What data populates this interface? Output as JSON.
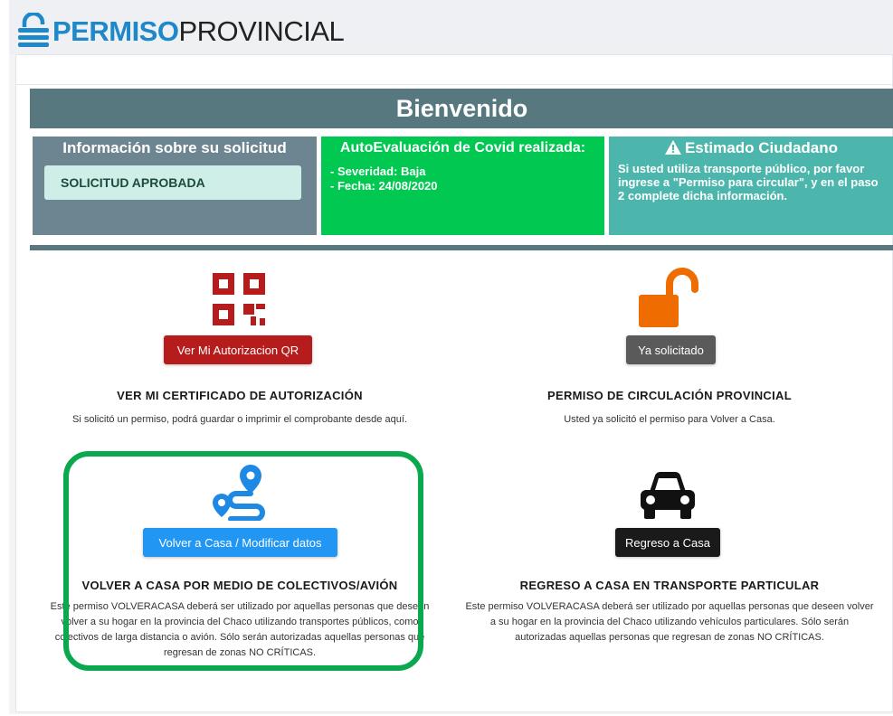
{
  "brand": {
    "part1": "PERMISO",
    "part2": "PROVINCIAL"
  },
  "welcome": "Bienvenido",
  "info_solicitud": {
    "title": "Información sobre su solicitud",
    "status": "SOLICITUD APROBADA"
  },
  "autoeval": {
    "title": "AutoEvaluación de Covid realizada:",
    "severity": "- Severidad: Baja",
    "date": "- Fecha: 24/08/2020"
  },
  "ciudadano": {
    "title": "Estimado Ciudadano",
    "text": "Si usted utiliza transporte público, por favor ingrese a \"Permiso para circular\", y en el paso 2 complete dicha información."
  },
  "features": [
    {
      "button": "Ver Mi Autorizacion QR",
      "title": "VER MI CERTIFICADO DE AUTORIZACIÓN",
      "desc": "Si solicitó un permiso, podrá guardar o imprimir el comprobante desde aquí.",
      "icon": "qr-code-icon"
    },
    {
      "button": "Ya solicitado",
      "title": "PERMISO DE CIRCULACIÓN PROVINCIAL",
      "desc": "Usted ya solicitó el permiso para Volver a Casa.",
      "icon": "unlock-icon"
    },
    {
      "button": "Volver a Casa / Modificar datos",
      "title": "VOLVER A CASA POR MEDIO DE COLECTIVOS/AVIÓN",
      "desc": "Este permiso VOLVERACASA deberá ser utilizado por aquellas personas que deseen volver a su hogar en la provincia del Chaco utilizando transportes públicos, como colectivos de larga distancia o avión. Sólo serán autorizadas aquellas personas que regresan de zonas NO CRÍTICAS.",
      "icon": "route-icon"
    },
    {
      "button": "Regreso a Casa",
      "title": "REGRESO A CASA EN TRANSPORTE PARTICULAR",
      "desc": "Este permiso VOLVERACASA deberá ser utilizado por aquellas personas que deseen volver a su hogar en la provincia del Chaco utilizando vehículos particulares. Sólo serán autorizadas aquellas personas que regresan de zonas NO CRÍTICAS.",
      "icon": "car-icon"
    }
  ],
  "colors": {
    "header": "#587880",
    "qr": "#b71c1c",
    "lock": "#ef6c00",
    "route": "#1e88e5",
    "green": "#00c851",
    "teal": "#4db6ac",
    "highlight": "#0aa84f"
  }
}
